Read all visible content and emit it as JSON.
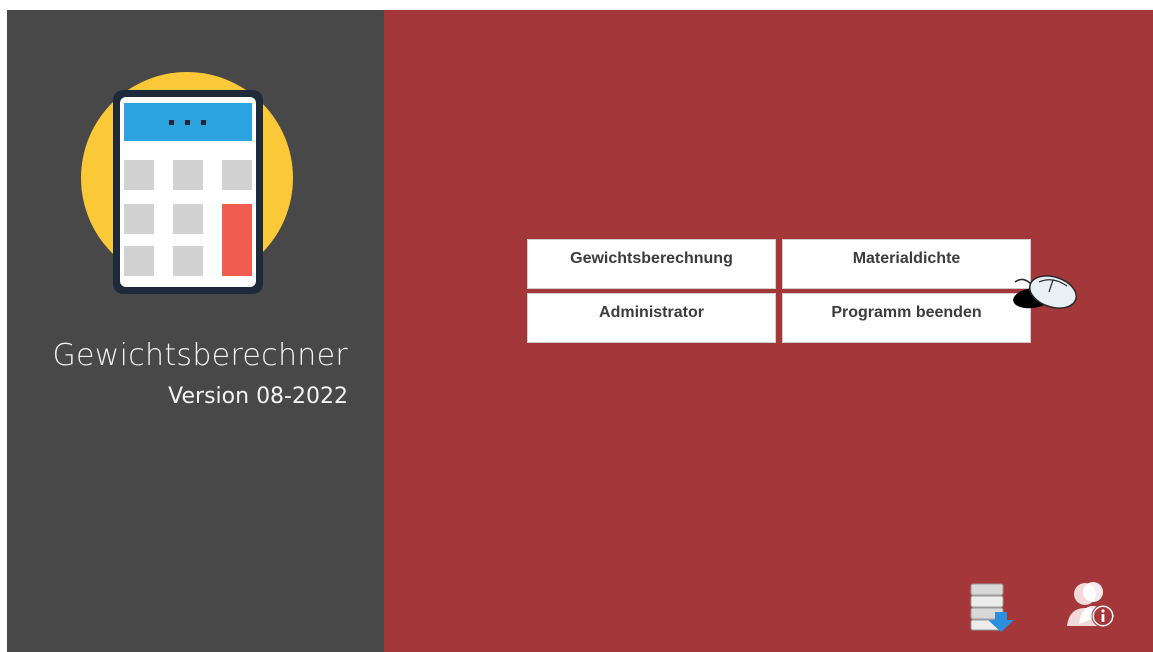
{
  "app": {
    "title": "Gewichtsberechner",
    "version": "Version 08-2022"
  },
  "menu": {
    "weight_calc": "Gewichtsberechnung",
    "material_density": "Materialdichte",
    "administrator": "Administrator",
    "exit": "Programm beenden"
  },
  "icons": {
    "logo": "calculator-icon",
    "cursor": "mouse-icon",
    "database": "database-download-icon",
    "user_info": "user-info-icon"
  },
  "colors": {
    "left_panel": "#484848",
    "right_panel": "#a3373a",
    "logo_circle": "#fbc937",
    "display": "#2ba3e0",
    "accent_key": "#f05c4f"
  }
}
